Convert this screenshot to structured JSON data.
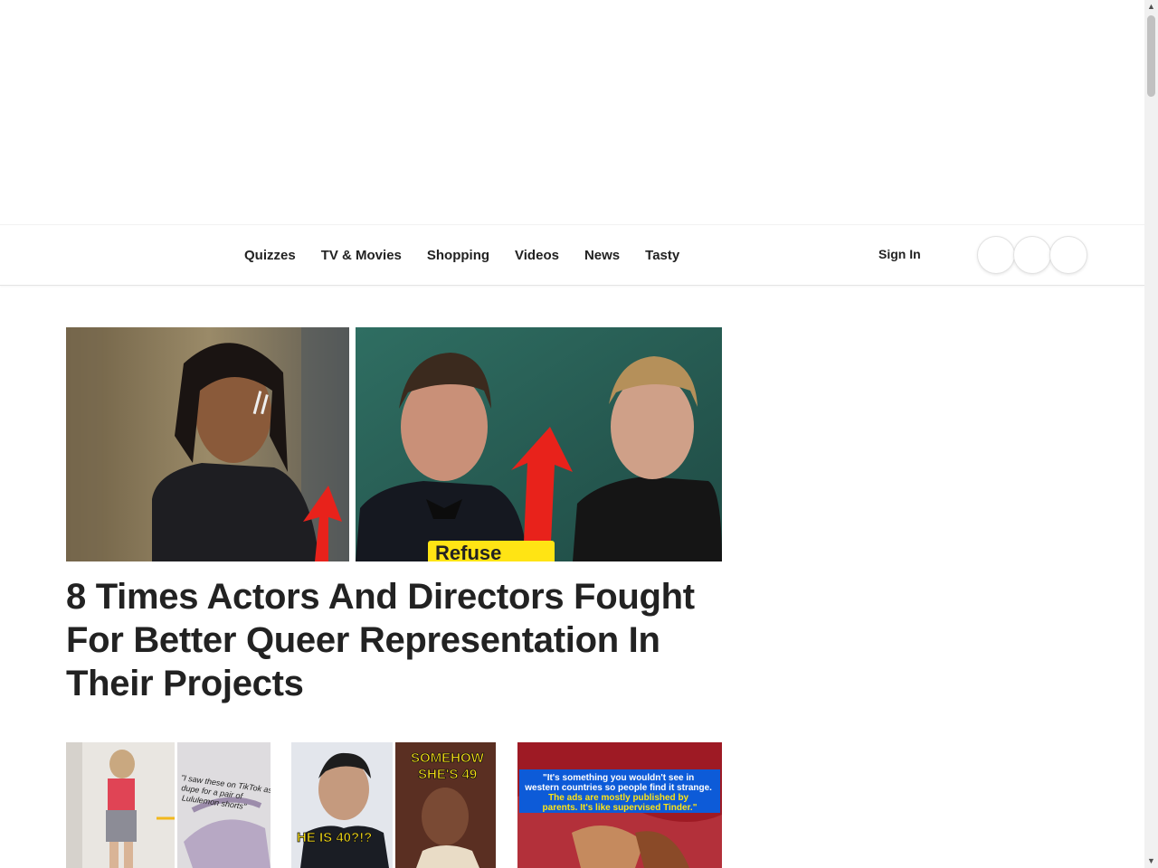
{
  "nav": {
    "links": [
      "Quizzes",
      "TV & Movies",
      "Shopping",
      "Videos",
      "News",
      "Tasty"
    ],
    "sign_in": "Sign In"
  },
  "hero": {
    "overlay_text": "Refuse",
    "headline": "8 Times Actors And Directors Fought For Better Queer Representation In Their Projects"
  },
  "thumbs": [
    {
      "caption": "\"I saw these on TikTok as a dupe for a pair of Lululemon shorts\""
    },
    {
      "left_text": "HE IS 40?!?",
      "right_text_1": "SOMEHOW",
      "right_text_2": "SHE'S 49"
    },
    {
      "caption_1": "\"It's something you wouldn't see in",
      "caption_2": "western countries so people find it strange.",
      "caption_3": "The ads are mostly published by",
      "caption_4": "parents. It's like supervised Tinder.\""
    }
  ],
  "colors": {
    "accent_red": "#e8221b",
    "caption_yellow": "#ffe414",
    "caption_blue": "#0d5bd8"
  }
}
